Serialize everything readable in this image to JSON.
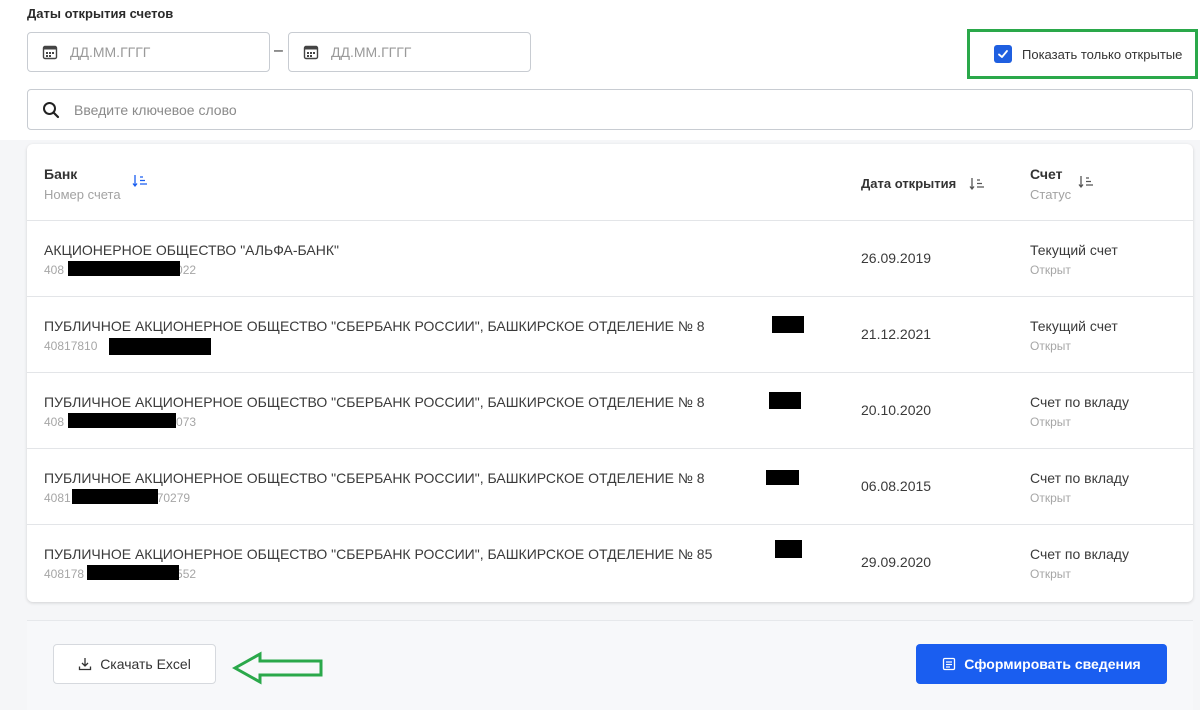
{
  "filters": {
    "section_label": "Даты открытия счетов",
    "date_from_placeholder": "ДД.ММ.ГГГГ",
    "date_to_placeholder": "ДД.ММ.ГГГГ",
    "date_separator": "–",
    "only_open_label": "Показать только открытые",
    "only_open_checked": true
  },
  "search": {
    "placeholder": "Введите ключевое слово"
  },
  "table": {
    "headers": {
      "bank": "Банк",
      "account_number": "Номер счета",
      "open_date": "Дата открытия",
      "account": "Счет",
      "status": "Статус"
    },
    "rows": [
      {
        "bank": "АКЦИОНЕРНОЕ ОБЩЕСТВО \"АЛЬФА-БАНК\"",
        "account_prefix": "408",
        "account_suffix": "022",
        "open_date": "26.09.2019",
        "account_type": "Текущий счет",
        "status": "Открыт"
      },
      {
        "bank": "ПУБЛИЧНОЕ АКЦИОНЕРНОЕ ОБЩЕСТВО \"СБЕРБАНК РОССИИ\", БАШКИРСКОЕ ОТДЕЛЕНИЕ № 8",
        "account_prefix": "40817810",
        "account_suffix": "",
        "open_date": "21.12.2021",
        "account_type": "Текущий счет",
        "status": "Открыт"
      },
      {
        "bank": "ПУБЛИЧНОЕ АКЦИОНЕРНОЕ ОБЩЕСТВО \"СБЕРБАНК РОССИИ\", БАШКИРСКОЕ ОТДЕЛЕНИЕ № 8",
        "account_prefix": "408",
        "account_suffix": "073",
        "open_date": "20.10.2020",
        "account_type": "Счет по вкладу",
        "status": "Открыт"
      },
      {
        "bank": "ПУБЛИЧНОЕ АКЦИОНЕРНОЕ ОБЩЕСТВО \"СБЕРБАНК РОССИИ\", БАШКИРСКОЕ ОТДЕЛЕНИЕ № 8",
        "account_prefix": "4081",
        "account_suffix": "70279",
        "open_date": "06.08.2015",
        "account_type": "Счет по вкладу",
        "status": "Открыт"
      },
      {
        "bank": "ПУБЛИЧНОЕ АКЦИОНЕРНОЕ ОБЩЕСТВО \"СБЕРБАНК РОССИИ\", БАШКИРСКОЕ ОТДЕЛЕНИЕ № 85",
        "account_prefix": "408178",
        "account_suffix": "552",
        "open_date": "29.09.2020",
        "account_type": "Счет по вкладу",
        "status": "Открыт"
      }
    ]
  },
  "footer": {
    "excel_button_label": "Скачать Excel",
    "form_button_label": "Сформировать сведения"
  },
  "colors": {
    "primary": "#1a5ef0",
    "highlight_annotation": "#2aa84a",
    "muted_text": "#a6a6a6"
  }
}
